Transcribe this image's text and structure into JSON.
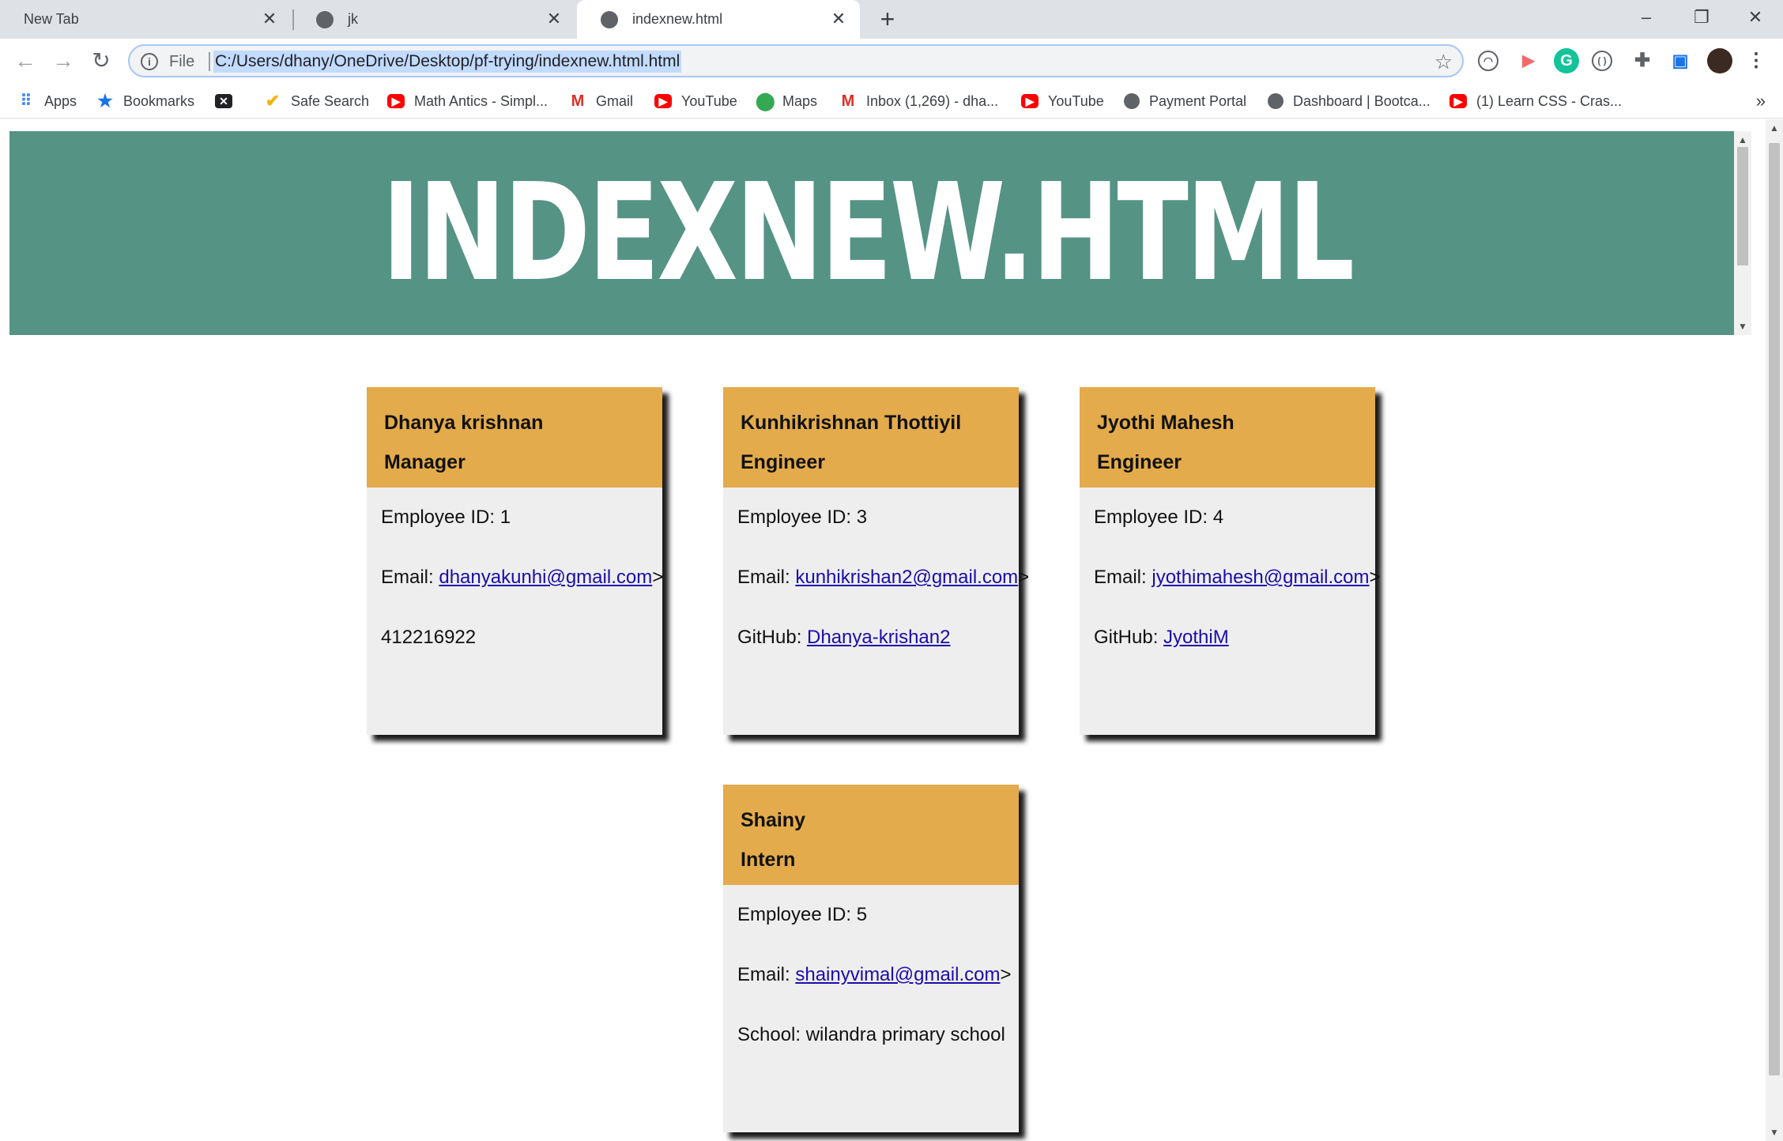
{
  "tabs": [
    {
      "title": "New Tab"
    },
    {
      "title": "jk"
    },
    {
      "title": "indexnew.html"
    }
  ],
  "omnibox": {
    "scheme": "File",
    "url": "C:/Users/dhany/OneDrive/Desktop/pf-trying/indexnew.html.html"
  },
  "bookmarks": [
    {
      "label": "Apps",
      "icon": "apps-grid-icon"
    },
    {
      "label": "Bookmarks",
      "icon": "star-icon"
    },
    {
      "label": "",
      "icon": "dark-app-icon"
    },
    {
      "label": "Safe Search",
      "icon": "checkmark-icon"
    },
    {
      "label": "Math Antics - Simpl...",
      "icon": "youtube-icon"
    },
    {
      "label": "Gmail",
      "icon": "gmail-icon"
    },
    {
      "label": "YouTube",
      "icon": "youtube-icon"
    },
    {
      "label": "Maps",
      "icon": "maps-pin-icon"
    },
    {
      "label": "Inbox (1,269) - dha...",
      "icon": "gmail-icon"
    },
    {
      "label": "YouTube",
      "icon": "youtube-icon"
    },
    {
      "label": "Payment Portal",
      "icon": "globe-icon"
    },
    {
      "label": "Dashboard | Bootca...",
      "icon": "globe-icon"
    },
    {
      "label": "(1) Learn CSS - Cras...",
      "icon": "youtube-icon"
    }
  ],
  "banner": {
    "title": "INDEXNEW.HTML"
  },
  "cards": [
    {
      "name": "Dhanya krishnan",
      "role": "Manager",
      "id_label": "Employee ID: 1",
      "email_label": "Email: ",
      "email": "dhanyakunhi@gmail.com",
      "email_suffix": ">",
      "extra_label": "412216922",
      "extra_link": ""
    },
    {
      "name": "Kunhikrishnan Thottiyil",
      "role": "Engineer",
      "id_label": "Employee ID: 3",
      "email_label": "Email: ",
      "email": "kunhikrishan2@gmail.com",
      "email_suffix": ">",
      "extra_label": "GitHub: ",
      "extra_link": "Dhanya-krishan2"
    },
    {
      "name": "Jyothi Mahesh",
      "role": "Engineer",
      "id_label": "Employee ID: 4",
      "email_label": "Email: ",
      "email": "jyothimahesh@gmail.com",
      "email_suffix": ">",
      "extra_label": "GitHub: ",
      "extra_link": "JyothiM"
    },
    {
      "name": "Shainy",
      "role": "Intern",
      "id_label": "Employee ID: 5",
      "email_label": "Email: ",
      "email": "shainyvimal@gmail.com",
      "email_suffix": ">",
      "extra_label": "School: wilandra primary school",
      "extra_link": ""
    }
  ],
  "colors": {
    "banner": "#559385",
    "card_header": "#e3ab4b",
    "card_body": "#efeeee",
    "link": "#1a0dab"
  }
}
